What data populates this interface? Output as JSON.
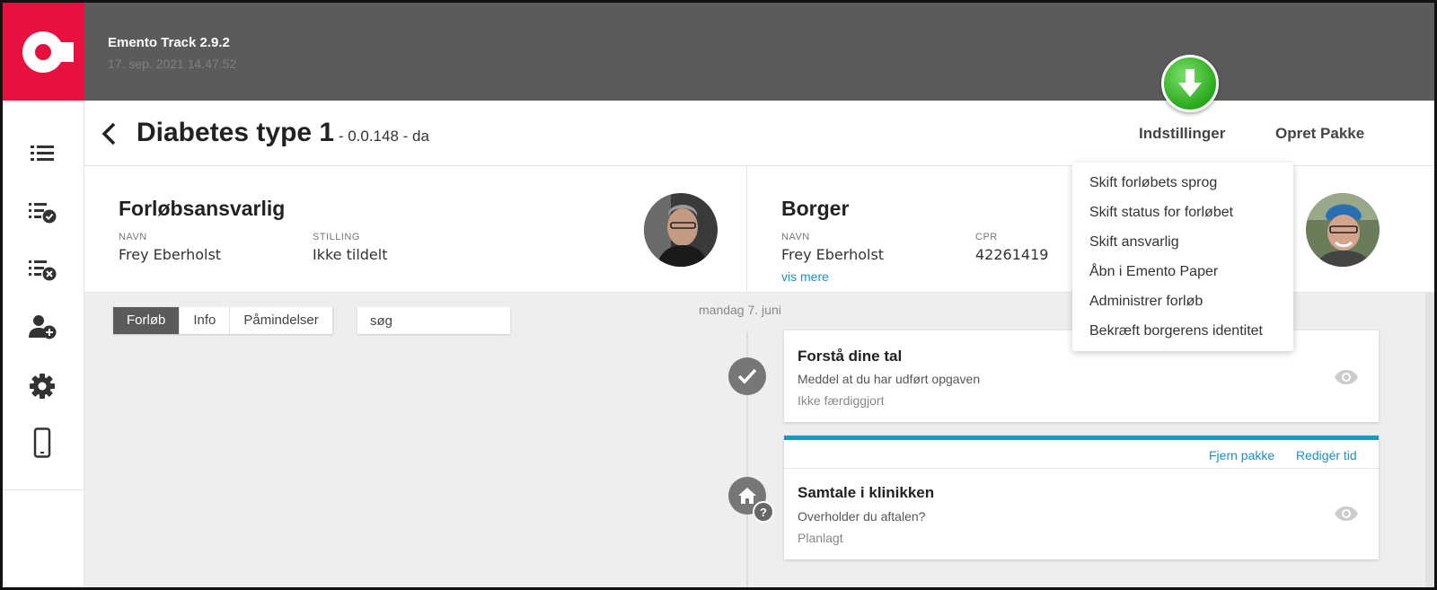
{
  "app": {
    "name": "Emento Track 2.9.2",
    "timestamp": "17. sep. 2021 14.47.52",
    "brand_color": "#e8103f",
    "topbar_color": "#5b5b5b",
    "accent_color": "#1a8fc6"
  },
  "sidebar": {
    "items": [
      {
        "icon": "list-icon"
      },
      {
        "icon": "list-check-icon"
      },
      {
        "icon": "list-remove-icon"
      },
      {
        "icon": "add-user-icon"
      },
      {
        "icon": "gear-icon"
      },
      {
        "icon": "mobile-phone-icon"
      }
    ]
  },
  "header": {
    "title": "Diabetes type 1",
    "subtitle": " - 0.0.148 - da",
    "settings_label": "Indstillinger",
    "create_package_label": "Opret Pakke"
  },
  "settings_menu": {
    "items": [
      "Skift forløbets sprog",
      "Skift status for forløbet",
      "Skift ansvarlig",
      "Åbn i Emento Paper",
      "Administrer forløb",
      "Bekræft borgerens identitet"
    ]
  },
  "responsible": {
    "title": "Forløbsansvarlig",
    "name_label": "NAVN",
    "name": "Frey Eberholst",
    "position_label": "STILLING",
    "position": "Ikke tildelt"
  },
  "citizen": {
    "title": "Borger",
    "name_label": "NAVN",
    "name": "Frey Eberholst",
    "cpr_label": "CPR",
    "cpr": "42261419",
    "more_label": "vis mere"
  },
  "tabs": {
    "items": [
      "Forløb",
      "Info",
      "Påmindelser"
    ],
    "active": "Forløb"
  },
  "search": {
    "placeholder": "søg"
  },
  "timeline": {
    "day_label": "mandag 7. juni",
    "tasks": [
      {
        "title": "Forstå dine tal",
        "description": "Meddel at du har udført opgaven",
        "status": "Ikke færdiggjort"
      },
      {
        "remove_label": "Fjern pakke",
        "edit_label": "Redigér tid",
        "title": "Samtale i klinikken",
        "description": "Overholder du aftalen?",
        "status": "Planlagt",
        "badge": "?"
      }
    ]
  }
}
